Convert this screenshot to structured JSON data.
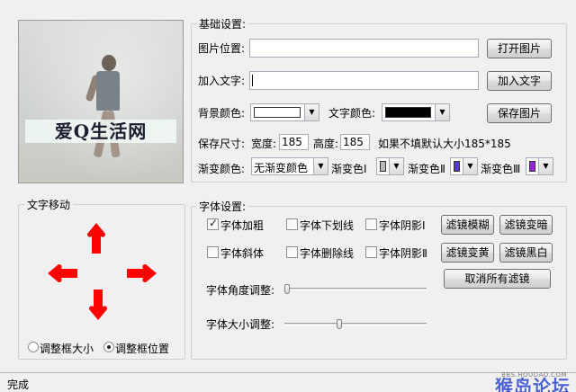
{
  "preview": {
    "caption": "爱Q生活网"
  },
  "basic_settings": {
    "title": "基础设置:",
    "image_location_label": "图片位置:",
    "image_location_value": "",
    "open_image_button": "打开图片",
    "add_text_label": "加入文字:",
    "add_text_value": "",
    "add_text_button": "加入文字",
    "bg_color_label": "背景颜色:",
    "bg_color": "#ffffff",
    "text_color_label": "文字颜色:",
    "text_color": "#000000",
    "save_image_button": "保存图片",
    "save_size_label": "保存尺寸:",
    "width_label": "宽度:",
    "width_value": "185",
    "height_label": "高度:",
    "height_value": "185",
    "size_hint": "如果不填默认大小185*185",
    "gradient_label": "渐变颜色:",
    "gradient_value": "无渐变颜色",
    "gradient1_label": "渐变色Ⅰ",
    "gradient1_color": "#b8b8b8",
    "gradient2_label": "渐变色Ⅱ",
    "gradient2_color": "#5a3ccc",
    "gradient3_label": "渐变色Ⅲ",
    "gradient3_color": "#9a22d8"
  },
  "text_move": {
    "title": "文字移动",
    "arrow_color": "#ff0000",
    "adjust_size_label": "调整框大小",
    "adjust_position_label": "调整框位置",
    "selected": "position"
  },
  "font_settings": {
    "title": "字体设置:",
    "bold_label": "字体加粗",
    "bold_checked": true,
    "underline_label": "字体下划线",
    "underline_checked": false,
    "shadow1_label": "字体阴影Ⅰ",
    "shadow1_checked": false,
    "italic_label": "字体斜体",
    "italic_checked": false,
    "strike_label": "字体删除线",
    "strike_checked": false,
    "shadow2_label": "字体阴影Ⅱ",
    "shadow2_checked": false,
    "blur_button": "滤镜模糊",
    "darken_button": "滤镜变暗",
    "yellow_button": "滤镜变黄",
    "bw_button": "滤镜黑白",
    "cancel_filters_button": "取消所有滤镜",
    "angle_label": "字体角度调整:",
    "angle_value": 0,
    "size_label": "字体大小调整:",
    "size_value": 0.38
  },
  "status": {
    "text": "完成"
  },
  "watermark": {
    "main": "猴岛论坛",
    "sub": "BBS.HOUDAO.COM"
  }
}
